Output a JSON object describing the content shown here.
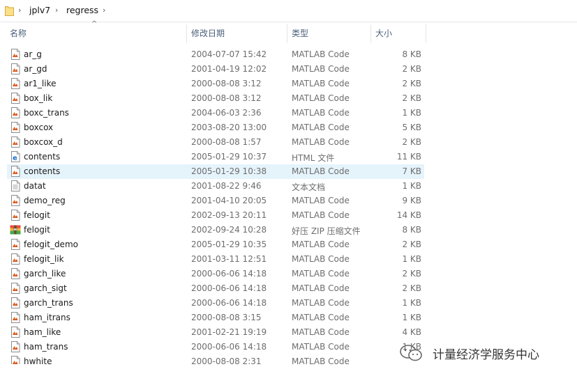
{
  "breadcrumb": [
    "jplv7",
    "regress"
  ],
  "columns": {
    "name": "名称",
    "date": "修改日期",
    "type": "类型",
    "size": "大小"
  },
  "files": [
    {
      "name": "ar_g",
      "date": "2004-07-07 15:42",
      "type": "MATLAB Code",
      "size": "8 KB",
      "icon": "matlab-file-icon"
    },
    {
      "name": "ar_gd",
      "date": "2001-04-19 12:02",
      "type": "MATLAB Code",
      "size": "2 KB",
      "icon": "matlab-file-icon"
    },
    {
      "name": "ar1_like",
      "date": "2000-08-08 3:12",
      "type": "MATLAB Code",
      "size": "2 KB",
      "icon": "matlab-file-icon"
    },
    {
      "name": "box_lik",
      "date": "2000-08-08 3:12",
      "type": "MATLAB Code",
      "size": "2 KB",
      "icon": "matlab-file-icon"
    },
    {
      "name": "boxc_trans",
      "date": "2004-06-03 2:36",
      "type": "MATLAB Code",
      "size": "1 KB",
      "icon": "matlab-file-icon"
    },
    {
      "name": "boxcox",
      "date": "2003-08-20 13:00",
      "type": "MATLAB Code",
      "size": "5 KB",
      "icon": "matlab-file-icon"
    },
    {
      "name": "boxcox_d",
      "date": "2000-08-08 1:57",
      "type": "MATLAB Code",
      "size": "2 KB",
      "icon": "matlab-file-icon"
    },
    {
      "name": "contents",
      "date": "2005-01-29 10:37",
      "type": "HTML 文件",
      "size": "11 KB",
      "icon": "html-file-icon"
    },
    {
      "name": "contents",
      "date": "2005-01-29 10:38",
      "type": "MATLAB Code",
      "size": "7 KB",
      "icon": "matlab-file-icon",
      "selected": true
    },
    {
      "name": "datat",
      "date": "2001-08-22 9:46",
      "type": "文本文档",
      "size": "1 KB",
      "icon": "text-file-icon"
    },
    {
      "name": "demo_reg",
      "date": "2001-04-10 20:05",
      "type": "MATLAB Code",
      "size": "9 KB",
      "icon": "matlab-file-icon"
    },
    {
      "name": "felogit",
      "date": "2002-09-13 20:11",
      "type": "MATLAB Code",
      "size": "14 KB",
      "icon": "matlab-file-icon"
    },
    {
      "name": "felogit",
      "date": "2002-09-24 10:28",
      "type": "好压 ZIP 压缩文件",
      "size": "8 KB",
      "icon": "zip-archive-icon"
    },
    {
      "name": "felogit_demo",
      "date": "2005-01-29 10:35",
      "type": "MATLAB Code",
      "size": "2 KB",
      "icon": "matlab-file-icon"
    },
    {
      "name": "felogit_lik",
      "date": "2001-03-11 12:51",
      "type": "MATLAB Code",
      "size": "1 KB",
      "icon": "matlab-file-icon"
    },
    {
      "name": "garch_like",
      "date": "2000-06-06 14:18",
      "type": "MATLAB Code",
      "size": "2 KB",
      "icon": "matlab-file-icon"
    },
    {
      "name": "garch_sigt",
      "date": "2000-06-06 14:18",
      "type": "MATLAB Code",
      "size": "2 KB",
      "icon": "matlab-file-icon"
    },
    {
      "name": "garch_trans",
      "date": "2000-06-06 14:18",
      "type": "MATLAB Code",
      "size": "1 KB",
      "icon": "matlab-file-icon"
    },
    {
      "name": "ham_itrans",
      "date": "2000-08-08 3:15",
      "type": "MATLAB Code",
      "size": "1 KB",
      "icon": "matlab-file-icon"
    },
    {
      "name": "ham_like",
      "date": "2001-02-21 19:19",
      "type": "MATLAB Code",
      "size": "4 KB",
      "icon": "matlab-file-icon"
    },
    {
      "name": "ham_trans",
      "date": "2000-06-06 14:18",
      "type": "MATLAB Code",
      "size": "1 KB",
      "icon": "matlab-file-icon"
    },
    {
      "name": "hwhite",
      "date": "2000-08-08 2:31",
      "type": "MATLAB Code",
      "size": "",
      "icon": "matlab-file-icon"
    }
  ],
  "watermark": {
    "text": "计量经济学服务中心",
    "icon": "wechat-logo-icon"
  },
  "colors": {
    "selected_row": "#e5f3fb",
    "header_text": "#4c607a",
    "secondary_text": "#6d6d6d"
  }
}
